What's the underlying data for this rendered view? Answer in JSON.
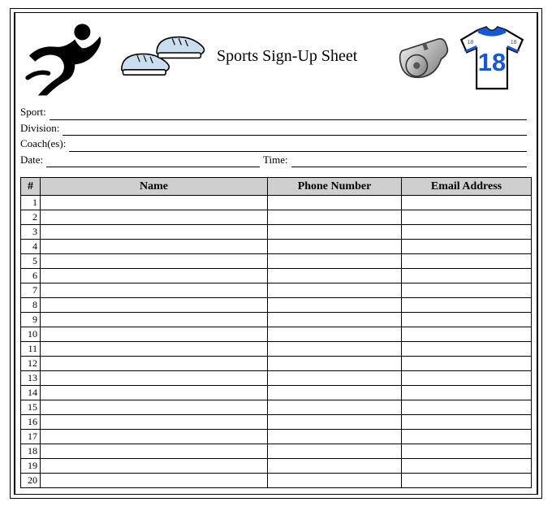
{
  "title": "Sports Sign-Up Sheet",
  "fields": {
    "sport_label": "Sport:",
    "division_label": "Division:",
    "coaches_label": "Coach(es):",
    "date_label": "Date:",
    "time_label": "Time:"
  },
  "jersey_number": "18",
  "table": {
    "headers": {
      "num": "#",
      "name": "Name",
      "phone": "Phone Number",
      "email": "Email Address"
    },
    "rows": [
      "1",
      "2",
      "3",
      "4",
      "5",
      "6",
      "7",
      "8",
      "9",
      "10",
      "11",
      "12",
      "13",
      "14",
      "15",
      "16",
      "17",
      "18",
      "19",
      "20"
    ]
  }
}
